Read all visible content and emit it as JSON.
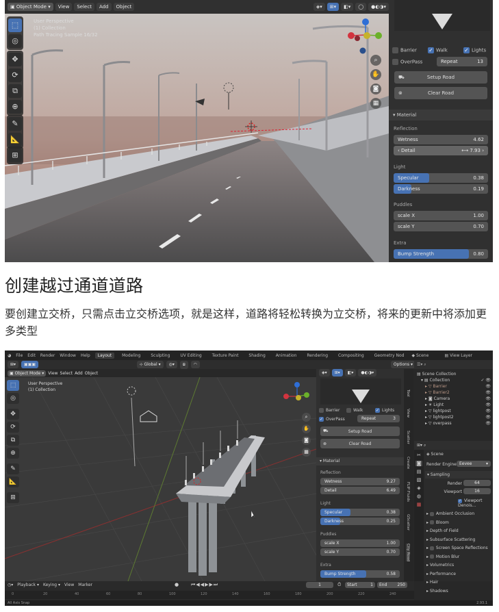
{
  "screenshot1": {
    "header": {
      "mode_label": "Object Mode",
      "menus": [
        "View",
        "Select",
        "Add",
        "Object"
      ]
    },
    "viewport": {
      "overlay_lines": [
        "User Perspective",
        "(1) Collection",
        "Path Tracing Sample 16/32"
      ]
    },
    "panel": {
      "checkboxes": [
        {
          "label": "Barrier",
          "checked": false
        },
        {
          "label": "Walk",
          "checked": true
        },
        {
          "label": "Lights",
          "checked": true
        },
        {
          "label": "OverPass",
          "checked": false
        }
      ],
      "repeat": {
        "label": "Repeat",
        "value": "13"
      },
      "setup_road": "Setup Road",
      "clear_road": "Clear Road",
      "material_header": "Material",
      "reflection_label": "Reflection",
      "wetness": {
        "label": "Wetness",
        "value": "4.62"
      },
      "detail": {
        "label": "Detail",
        "value": "7.93"
      },
      "light_label": "Light",
      "specular": {
        "label": "Specular",
        "value": "0.38",
        "fill": 0.38
      },
      "darkness": {
        "label": "Darkness",
        "value": "0.19",
        "fill": 0.19
      },
      "puddles_label": "Puddles",
      "scale_x": {
        "label": "scale X",
        "value": "1.00"
      },
      "scale_y": {
        "label": "scale Y",
        "value": "0.70"
      },
      "extra_label": "Extra",
      "bump": {
        "label": "Bump Strength",
        "value": "0.80",
        "fill": 0.8
      }
    }
  },
  "article": {
    "heading": "创建越过通道道路",
    "paragraph": "要创建立交桥，只需点击立交桥选项，就是这样，道路将轻松转换为立交桥，将来的更新中将添加更多类型"
  },
  "screenshot2": {
    "menubar": [
      "File",
      "Edit",
      "Render",
      "Window",
      "Help"
    ],
    "workspaces": [
      "Layout",
      "Modeling",
      "Sculpting",
      "UV Editing",
      "Texture Paint",
      "Shading",
      "Animation",
      "Rendering",
      "Compositing",
      "Geometry Nod"
    ],
    "scene_label": "Scene",
    "view_layer_label": "View Layer",
    "header": {
      "mode_label": "Object Mode",
      "menus": [
        "View",
        "Select",
        "Add",
        "Object"
      ],
      "transform": "Global",
      "options": "Options"
    },
    "viewport": {
      "overlay_lines": [
        "User Perspective",
        "(1) Collection"
      ]
    },
    "panel": {
      "checkboxes": [
        {
          "label": "Barrier",
          "checked": false
        },
        {
          "label": "Walk",
          "checked": false
        },
        {
          "label": "Lights",
          "checked": true
        },
        {
          "label": "OverPass",
          "checked": true
        }
      ],
      "repeat": {
        "label": "Repeat",
        "value": "3"
      },
      "setup_road": "Setup Road",
      "clear_road": "Clear Road",
      "material_header": "Material",
      "reflection_label": "Reflection",
      "wetness": {
        "label": "Wetness",
        "value": "9.27"
      },
      "detail": {
        "label": "Detail",
        "value": "6.49"
      },
      "light_label": "Light",
      "specular": {
        "label": "Specular",
        "value": "0.38",
        "fill": 0.38
      },
      "darkness": {
        "label": "Darkness",
        "value": "0.25",
        "fill": 0.25
      },
      "puddles_label": "Puddles",
      "scale_x": {
        "label": "scale X",
        "value": "1.00"
      },
      "scale_y": {
        "label": "scale Y",
        "value": "0.70"
      },
      "extra_label": "Extra",
      "bump": {
        "label": "Bump Strength",
        "value": "0.58",
        "fill": 0.58
      }
    },
    "side_tabs": [
      "Tool",
      "View",
      "Scatter",
      "Create",
      "FLIP Fluids",
      "GScatter",
      "City Road"
    ],
    "outliner": {
      "title": "Scene Collection",
      "items": [
        "Collection",
        "Barrier",
        "Barrier2",
        "Camera",
        "Light",
        "lightpost",
        "lightpost2",
        "overpass"
      ]
    },
    "properties": {
      "scene": "Scene",
      "render_engine_label": "Render Engine",
      "render_engine_value": "Eevee",
      "sampling_header": "Sampling",
      "render_label": "Render",
      "render_value": "64",
      "viewport_label": "Viewport",
      "viewport_value": "16",
      "viewport_denoise": "Viewport Denois...",
      "sections": [
        "Ambient Occlusion",
        "Bloom",
        "Depth of Field",
        "Subsurface Scattering",
        "Screen Space Reflections",
        "Motion Blur",
        "Volumetrics",
        "Performance",
        "Hair",
        "Shadows"
      ]
    },
    "timeline": {
      "menus": [
        "Playback",
        "Keying",
        "View",
        "Marker"
      ],
      "frame": "1",
      "start_label": "Start",
      "start_value": "1",
      "end_label": "End",
      "end_value": "250",
      "ticks": [
        "0",
        "20",
        "40",
        "60",
        "80",
        "100",
        "120",
        "140",
        "160",
        "180",
        "200",
        "220",
        "240"
      ]
    },
    "status": {
      "left": "All   Axis Snap",
      "right": "2.93.1"
    }
  }
}
